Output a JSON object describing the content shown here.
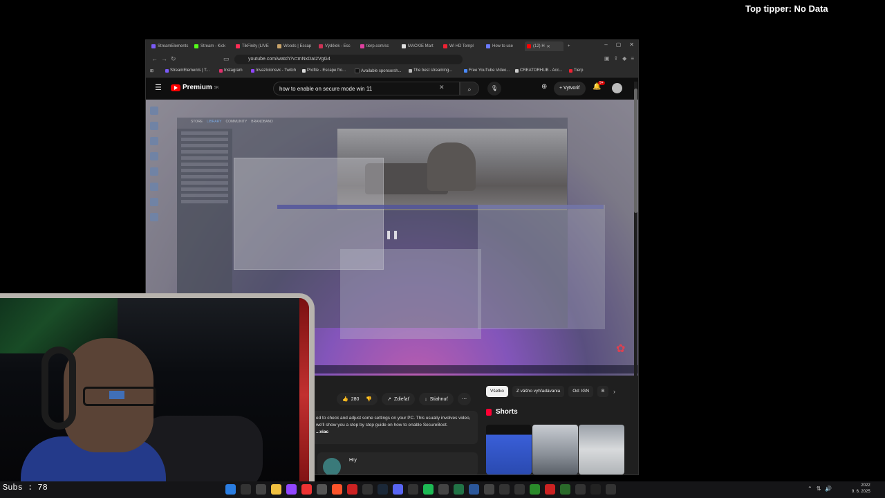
{
  "overlay": {
    "top_tipper": "Top tipper: No Data",
    "subs": "Subs : 78"
  },
  "browser": {
    "tabs": [
      {
        "label": "StreamElements",
        "color": "#7a5af8"
      },
      {
        "label": "Stream - Kick",
        "color": "#53fc18"
      },
      {
        "label": "TikFinity (LIVE",
        "color": "#fe2c55"
      },
      {
        "label": "Woods | Escap",
        "color": "#c9a46a"
      },
      {
        "label": "Výdělek - Esc",
        "color": "#cc3355"
      },
      {
        "label": "tierp.com/sc",
        "color": "#e040a0"
      },
      {
        "label": "MACKIE Mart",
        "color": "#ddd"
      },
      {
        "label": "Wi HD Templ",
        "color": "#e23"
      },
      {
        "label": "How to use",
        "color": "#6a7aff"
      },
      {
        "label": "(12) H",
        "color": "#f00"
      }
    ],
    "url": "youtube.com/watch?v=mNxDaI2VgG4",
    "bookmarks": [
      "StreamElements | T...",
      "Instagram",
      "Invazícionsvk - Twitch",
      "Profile - Escape fro...",
      "Available sponsorsh...",
      "The best streaming...",
      "Free YouTube Video...",
      "CREATORHUB - Acc...",
      "Tierp"
    ]
  },
  "youtube": {
    "logo": "Premium",
    "logo_sup": "SK",
    "search_query": "how to enable on secure mode win 11",
    "create_label": "Vytvoriť",
    "bell_badge": "9+",
    "progress": 0.38,
    "like_count": "280",
    "share_label": "Zdieľať",
    "download_label": "Stiahnuť",
    "description": "ed to check and adjust some settings on your PC. This usually involves video, we'll show you a step by step guide on how to enable SecureBoot.",
    "more_label": "...viac",
    "channel_name": "Hry",
    "chips": [
      "Všetko",
      "Z vášho vyhľadávania",
      "Od: IGN",
      "B"
    ],
    "shorts_label": "Shorts",
    "steam_tabs": [
      "STORE",
      "LIBRARY",
      "COMMUNITY",
      "BRANDBAND"
    ]
  },
  "taskbar": {
    "date": "2022",
    "date2": "9. 6. 2025"
  }
}
